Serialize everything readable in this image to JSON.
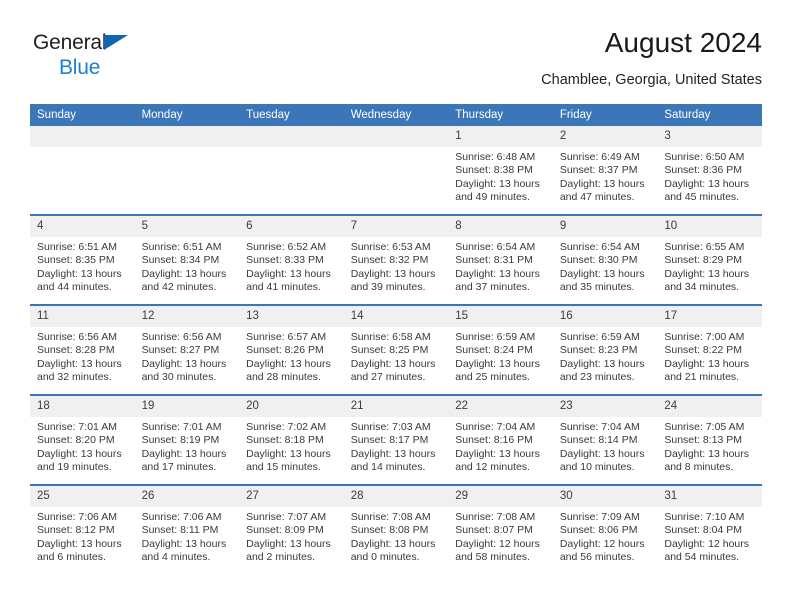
{
  "brand": {
    "name_top": "General",
    "name_bottom": "Blue",
    "triangle_color": "#1266b0",
    "blue_color": "#1c7fd4"
  },
  "header": {
    "title": "August 2024",
    "subtitle": "Chamblee, Georgia, United States"
  },
  "theme": {
    "header_row_color": "#3a76b8",
    "day_band_color": "#f0f0f0",
    "cell_background": "#ffffff",
    "text_color": "#3a3a3a"
  },
  "weekdays": [
    "Sunday",
    "Monday",
    "Tuesday",
    "Wednesday",
    "Thursday",
    "Friday",
    "Saturday"
  ],
  "weeks": [
    [
      {
        "day": "",
        "sunrise": "",
        "sunset": "",
        "daylight_line1": "",
        "daylight_line2": ""
      },
      {
        "day": "",
        "sunrise": "",
        "sunset": "",
        "daylight_line1": "",
        "daylight_line2": ""
      },
      {
        "day": "",
        "sunrise": "",
        "sunset": "",
        "daylight_line1": "",
        "daylight_line2": ""
      },
      {
        "day": "",
        "sunrise": "",
        "sunset": "",
        "daylight_line1": "",
        "daylight_line2": ""
      },
      {
        "day": "1",
        "sunrise": "Sunrise: 6:48 AM",
        "sunset": "Sunset: 8:38 PM",
        "daylight_line1": "Daylight: 13 hours",
        "daylight_line2": "and 49 minutes."
      },
      {
        "day": "2",
        "sunrise": "Sunrise: 6:49 AM",
        "sunset": "Sunset: 8:37 PM",
        "daylight_line1": "Daylight: 13 hours",
        "daylight_line2": "and 47 minutes."
      },
      {
        "day": "3",
        "sunrise": "Sunrise: 6:50 AM",
        "sunset": "Sunset: 8:36 PM",
        "daylight_line1": "Daylight: 13 hours",
        "daylight_line2": "and 45 minutes."
      }
    ],
    [
      {
        "day": "4",
        "sunrise": "Sunrise: 6:51 AM",
        "sunset": "Sunset: 8:35 PM",
        "daylight_line1": "Daylight: 13 hours",
        "daylight_line2": "and 44 minutes."
      },
      {
        "day": "5",
        "sunrise": "Sunrise: 6:51 AM",
        "sunset": "Sunset: 8:34 PM",
        "daylight_line1": "Daylight: 13 hours",
        "daylight_line2": "and 42 minutes."
      },
      {
        "day": "6",
        "sunrise": "Sunrise: 6:52 AM",
        "sunset": "Sunset: 8:33 PM",
        "daylight_line1": "Daylight: 13 hours",
        "daylight_line2": "and 41 minutes."
      },
      {
        "day": "7",
        "sunrise": "Sunrise: 6:53 AM",
        "sunset": "Sunset: 8:32 PM",
        "daylight_line1": "Daylight: 13 hours",
        "daylight_line2": "and 39 minutes."
      },
      {
        "day": "8",
        "sunrise": "Sunrise: 6:54 AM",
        "sunset": "Sunset: 8:31 PM",
        "daylight_line1": "Daylight: 13 hours",
        "daylight_line2": "and 37 minutes."
      },
      {
        "day": "9",
        "sunrise": "Sunrise: 6:54 AM",
        "sunset": "Sunset: 8:30 PM",
        "daylight_line1": "Daylight: 13 hours",
        "daylight_line2": "and 35 minutes."
      },
      {
        "day": "10",
        "sunrise": "Sunrise: 6:55 AM",
        "sunset": "Sunset: 8:29 PM",
        "daylight_line1": "Daylight: 13 hours",
        "daylight_line2": "and 34 minutes."
      }
    ],
    [
      {
        "day": "11",
        "sunrise": "Sunrise: 6:56 AM",
        "sunset": "Sunset: 8:28 PM",
        "daylight_line1": "Daylight: 13 hours",
        "daylight_line2": "and 32 minutes."
      },
      {
        "day": "12",
        "sunrise": "Sunrise: 6:56 AM",
        "sunset": "Sunset: 8:27 PM",
        "daylight_line1": "Daylight: 13 hours",
        "daylight_line2": "and 30 minutes."
      },
      {
        "day": "13",
        "sunrise": "Sunrise: 6:57 AM",
        "sunset": "Sunset: 8:26 PM",
        "daylight_line1": "Daylight: 13 hours",
        "daylight_line2": "and 28 minutes."
      },
      {
        "day": "14",
        "sunrise": "Sunrise: 6:58 AM",
        "sunset": "Sunset: 8:25 PM",
        "daylight_line1": "Daylight: 13 hours",
        "daylight_line2": "and 27 minutes."
      },
      {
        "day": "15",
        "sunrise": "Sunrise: 6:59 AM",
        "sunset": "Sunset: 8:24 PM",
        "daylight_line1": "Daylight: 13 hours",
        "daylight_line2": "and 25 minutes."
      },
      {
        "day": "16",
        "sunrise": "Sunrise: 6:59 AM",
        "sunset": "Sunset: 8:23 PM",
        "daylight_line1": "Daylight: 13 hours",
        "daylight_line2": "and 23 minutes."
      },
      {
        "day": "17",
        "sunrise": "Sunrise: 7:00 AM",
        "sunset": "Sunset: 8:22 PM",
        "daylight_line1": "Daylight: 13 hours",
        "daylight_line2": "and 21 minutes."
      }
    ],
    [
      {
        "day": "18",
        "sunrise": "Sunrise: 7:01 AM",
        "sunset": "Sunset: 8:20 PM",
        "daylight_line1": "Daylight: 13 hours",
        "daylight_line2": "and 19 minutes."
      },
      {
        "day": "19",
        "sunrise": "Sunrise: 7:01 AM",
        "sunset": "Sunset: 8:19 PM",
        "daylight_line1": "Daylight: 13 hours",
        "daylight_line2": "and 17 minutes."
      },
      {
        "day": "20",
        "sunrise": "Sunrise: 7:02 AM",
        "sunset": "Sunset: 8:18 PM",
        "daylight_line1": "Daylight: 13 hours",
        "daylight_line2": "and 15 minutes."
      },
      {
        "day": "21",
        "sunrise": "Sunrise: 7:03 AM",
        "sunset": "Sunset: 8:17 PM",
        "daylight_line1": "Daylight: 13 hours",
        "daylight_line2": "and 14 minutes."
      },
      {
        "day": "22",
        "sunrise": "Sunrise: 7:04 AM",
        "sunset": "Sunset: 8:16 PM",
        "daylight_line1": "Daylight: 13 hours",
        "daylight_line2": "and 12 minutes."
      },
      {
        "day": "23",
        "sunrise": "Sunrise: 7:04 AM",
        "sunset": "Sunset: 8:14 PM",
        "daylight_line1": "Daylight: 13 hours",
        "daylight_line2": "and 10 minutes."
      },
      {
        "day": "24",
        "sunrise": "Sunrise: 7:05 AM",
        "sunset": "Sunset: 8:13 PM",
        "daylight_line1": "Daylight: 13 hours",
        "daylight_line2": "and 8 minutes."
      }
    ],
    [
      {
        "day": "25",
        "sunrise": "Sunrise: 7:06 AM",
        "sunset": "Sunset: 8:12 PM",
        "daylight_line1": "Daylight: 13 hours",
        "daylight_line2": "and 6 minutes."
      },
      {
        "day": "26",
        "sunrise": "Sunrise: 7:06 AM",
        "sunset": "Sunset: 8:11 PM",
        "daylight_line1": "Daylight: 13 hours",
        "daylight_line2": "and 4 minutes."
      },
      {
        "day": "27",
        "sunrise": "Sunrise: 7:07 AM",
        "sunset": "Sunset: 8:09 PM",
        "daylight_line1": "Daylight: 13 hours",
        "daylight_line2": "and 2 minutes."
      },
      {
        "day": "28",
        "sunrise": "Sunrise: 7:08 AM",
        "sunset": "Sunset: 8:08 PM",
        "daylight_line1": "Daylight: 13 hours",
        "daylight_line2": "and 0 minutes."
      },
      {
        "day": "29",
        "sunrise": "Sunrise: 7:08 AM",
        "sunset": "Sunset: 8:07 PM",
        "daylight_line1": "Daylight: 12 hours",
        "daylight_line2": "and 58 minutes."
      },
      {
        "day": "30",
        "sunrise": "Sunrise: 7:09 AM",
        "sunset": "Sunset: 8:06 PM",
        "daylight_line1": "Daylight: 12 hours",
        "daylight_line2": "and 56 minutes."
      },
      {
        "day": "31",
        "sunrise": "Sunrise: 7:10 AM",
        "sunset": "Sunset: 8:04 PM",
        "daylight_line1": "Daylight: 12 hours",
        "daylight_line2": "and 54 minutes."
      }
    ]
  ]
}
